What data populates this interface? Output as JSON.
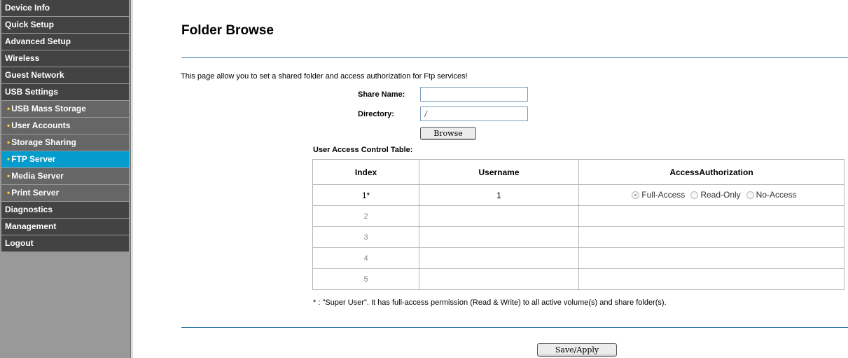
{
  "sidebar": {
    "items": [
      {
        "label": "Device Info",
        "kind": "main"
      },
      {
        "label": "Quick Setup",
        "kind": "main"
      },
      {
        "label": "Advanced Setup",
        "kind": "main"
      },
      {
        "label": "Wireless",
        "kind": "main"
      },
      {
        "label": "Guest Network",
        "kind": "main"
      },
      {
        "label": "USB Settings",
        "kind": "main"
      },
      {
        "label": "USB Mass Storage",
        "kind": "sub"
      },
      {
        "label": "User Accounts",
        "kind": "sub"
      },
      {
        "label": "Storage Sharing",
        "kind": "sub"
      },
      {
        "label": "FTP Server",
        "kind": "sub",
        "active": true
      },
      {
        "label": "Media Server",
        "kind": "sub"
      },
      {
        "label": "Print Server",
        "kind": "sub"
      },
      {
        "label": "Diagnostics",
        "kind": "main"
      },
      {
        "label": "Management",
        "kind": "main"
      },
      {
        "label": "Logout",
        "kind": "main"
      }
    ],
    "bullet": "•"
  },
  "page": {
    "title": "Folder Browse",
    "intro": "This page allow you to set a shared folder and access authorization for Ftp services!"
  },
  "form": {
    "share_name_label": "Share Name:",
    "share_name_value": "",
    "directory_label": "Directory:",
    "directory_value": "/",
    "browse_label": "Browse"
  },
  "table": {
    "caption": "User Access Control Table:",
    "headers": {
      "index": "Index",
      "username": "Username",
      "auth": "AccessAuthorization"
    },
    "rows": [
      {
        "index": "1*",
        "username": "1"
      },
      {
        "index": "2",
        "username": ""
      },
      {
        "index": "3",
        "username": ""
      },
      {
        "index": "4",
        "username": ""
      },
      {
        "index": "5",
        "username": ""
      }
    ],
    "auth_options": [
      "Full-Access",
      "Read-Only",
      "No-Access"
    ],
    "auth_selected": "Full-Access"
  },
  "note": "* : \"Super User\". It has full-access permission (Read & Write) to all active volume(s) and share folder(s).",
  "footer": {
    "save_label": "Save/Apply"
  },
  "colors": {
    "active_nav": "#039ccd",
    "nav_main": "#434343",
    "nav_sub": "#666666",
    "rule": "#2f78a8",
    "bullet": "#ffcc33"
  }
}
